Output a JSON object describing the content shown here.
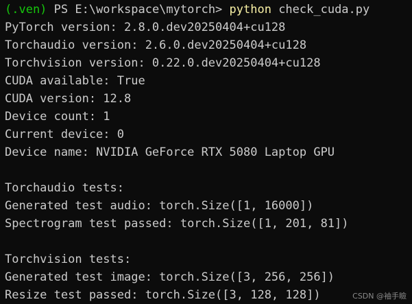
{
  "prompt": {
    "env": "(.ven)",
    "path": " PS E:\\workspace\\mytorch> ",
    "command": "python",
    "args": " check_cuda.py"
  },
  "output_lines": [
    "PyTorch version: 2.8.0.dev20250404+cu128",
    "Torchaudio version: 2.6.0.dev20250404+cu128",
    "Torchvision version: 0.22.0.dev20250404+cu128",
    "CUDA available: True",
    "CUDA version: 12.8",
    "Device count: 1",
    "Current device: 0",
    "Device name: NVIDIA GeForce RTX 5080 Laptop GPU",
    "",
    "Torchaudio tests:",
    "Generated test audio: torch.Size([1, 16000])",
    "Spectrogram test passed: torch.Size([1, 201, 81])",
    "",
    "Torchvision tests:",
    "Generated test image: torch.Size([3, 256, 256])",
    "Resize test passed: torch.Size([3, 128, 128])"
  ],
  "watermark": "CSDN @袖手瞼",
  "colors": {
    "background": "#0c0c0c",
    "text": "#cccccc",
    "env": "#16c60c",
    "command": "#f9f1a5"
  }
}
